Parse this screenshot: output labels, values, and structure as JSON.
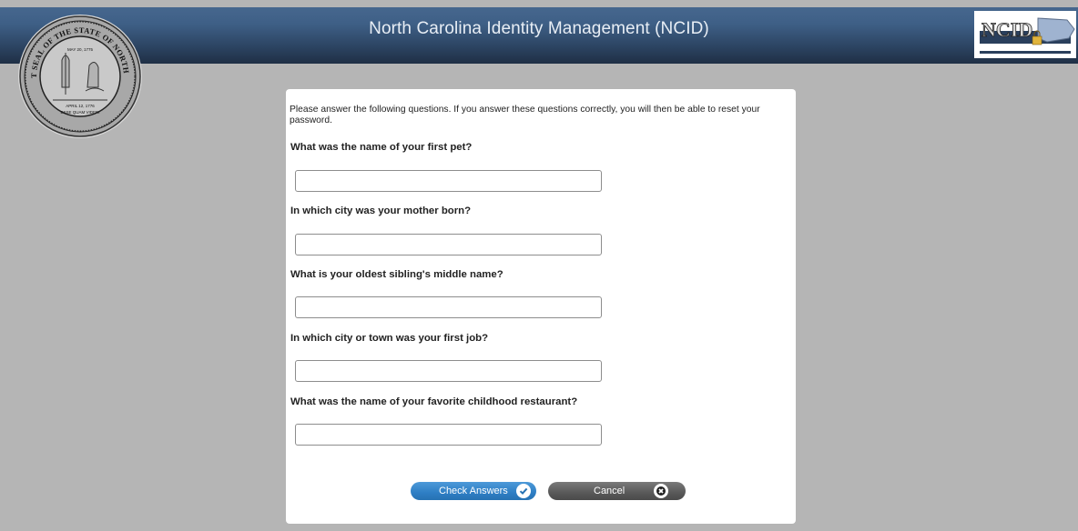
{
  "header": {
    "title": "North Carolina Identity Management (NCID)",
    "logo_text": "NCID",
    "seal_text_top": "THE GREAT SEAL OF THE STATE OF NORTH CAROLINA",
    "seal_date_top": "MAY 20, 1775",
    "seal_date_bottom": "APRIL 12, 1776",
    "seal_motto": "ESSE QUAM VIDERI"
  },
  "form": {
    "intro": "Please answer the following questions. If you answer these questions correctly, you will then be able to reset your password.",
    "questions": [
      {
        "label": "What was the name of your first pet?",
        "value": ""
      },
      {
        "label": "In which city was your mother born?",
        "value": ""
      },
      {
        "label": "What is your oldest sibling's middle name?",
        "value": ""
      },
      {
        "label": "In which city or town was your first job?",
        "value": ""
      },
      {
        "label": "What was the name of your favorite childhood restaurant?",
        "value": ""
      }
    ],
    "check_button": "Check Answers",
    "cancel_button": "Cancel"
  },
  "colors": {
    "header_blue": "#3e5f86",
    "background": "#b5b5b5",
    "check_button": "#2e7ec4",
    "cancel_button": "#595959"
  },
  "icons": {
    "check": "check-icon",
    "cancel": "close-icon"
  }
}
